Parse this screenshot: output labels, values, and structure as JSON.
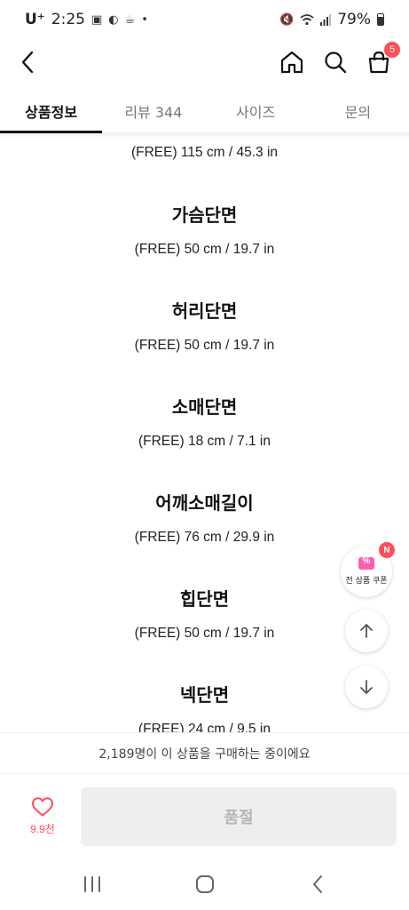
{
  "status_bar": {
    "carrier": "U⁺",
    "time": "2:25",
    "battery": "79%"
  },
  "header": {
    "cart_count": "5"
  },
  "tabs": [
    {
      "label": "상품정보",
      "active": true
    },
    {
      "label": "리뷰 344",
      "active": false
    },
    {
      "label": "사이즈",
      "active": false
    },
    {
      "label": "문의",
      "active": false
    }
  ],
  "size_info": {
    "top_partial_value": "(FREE) 115 cm / 45.3 in",
    "items": [
      {
        "title": "가슴단면",
        "value": "(FREE) 50 cm / 19.7 in"
      },
      {
        "title": "허리단면",
        "value": "(FREE) 50 cm / 19.7 in"
      },
      {
        "title": "소매단면",
        "value": "(FREE) 18 cm / 7.1 in"
      },
      {
        "title": "어깨소매길이",
        "value": "(FREE) 76 cm / 29.9 in"
      },
      {
        "title": "힙단면",
        "value": "(FREE) 50 cm / 19.7 in"
      },
      {
        "title": "넥단면",
        "value": "(FREE) 24 cm / 9.5 in"
      }
    ]
  },
  "floating": {
    "coupon_label": "전 상품 쿠폰",
    "new_badge": "N"
  },
  "purchase_info": "2,189명이 이 상품을 구매하는 중이에요",
  "action_bar": {
    "like_count": "9.9천",
    "soldout_label": "품절"
  },
  "colors": {
    "accent_red": "#ff4d5a",
    "coupon_pink": "#ff5db1",
    "disabled_button": "#eeeeee"
  },
  "icons": [
    "back-arrow-icon",
    "home-icon",
    "search-icon",
    "cart-icon",
    "coupon-icon",
    "arrow-up-icon",
    "arrow-down-icon",
    "heart-icon",
    "recent-apps-icon",
    "home-nav-icon",
    "back-nav-icon"
  ]
}
